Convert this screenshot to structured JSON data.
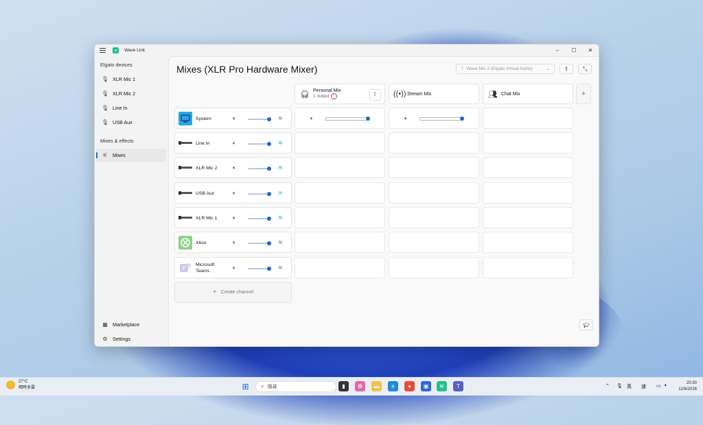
{
  "window": {
    "title": "Wave Link",
    "controls": [
      "–",
      "☐",
      "✕"
    ]
  },
  "sidebar": {
    "devices_heading": "Elgato devices",
    "devices": [
      {
        "label": "XLR Mic 1",
        "icon": "microphone-icon"
      },
      {
        "label": "XLR Mic 2",
        "icon": "microphone-icon"
      },
      {
        "label": "Line In",
        "icon": "microphone-icon"
      },
      {
        "label": "USB Aux",
        "icon": "microphone-icon"
      }
    ],
    "mixes_heading": "Mixes & effects",
    "mixes_item": "Mixes",
    "marketplace": "Marketplace",
    "settings": "Settings"
  },
  "main": {
    "title": "Mixes (XLR Pro Hardware Mixer)",
    "device_select": "Wave Mic 2 (Elgato Virtual Audio)",
    "mixes": [
      {
        "name": "Personal Mix",
        "sub": "1 output",
        "icon": "headphones-icon"
      },
      {
        "name": "Stream Mix",
        "icon": "broadcast-icon"
      },
      {
        "name": "Chat Mix",
        "icon": "people-icon"
      }
    ],
    "channels": [
      {
        "name": "System",
        "level": 0.9,
        "wave_active": false
      },
      {
        "name": "Line In",
        "level": 0.9,
        "wave_active": true
      },
      {
        "name": "XLR Mic 2",
        "level": 0.9,
        "wave_active": true
      },
      {
        "name": "USB Aux",
        "level": 0.9,
        "wave_active": true
      },
      {
        "name": "XLR Mic 1",
        "level": 0.9,
        "wave_active": true
      },
      {
        "name": "Xbox",
        "level": 0.9,
        "wave_active": false
      },
      {
        "name_line1": "Microsoft",
        "name_line2": "Teams",
        "level": 0.9,
        "wave_active": false
      }
    ],
    "system_personal_level": 1.0,
    "system_stream_level": 1.0,
    "create_channel": "Create channel"
  },
  "taskbar": {
    "weather_temp": "27°C",
    "weather_text": "晴時多雲",
    "search_placeholder": "搜尋",
    "lang_1": "英",
    "lang_2": "速",
    "time": "20:30",
    "date": "12/6/2026"
  },
  "colors": {
    "accent": "#1b6ac9",
    "wave_green": "#2fc47a",
    "warning": "#d33333"
  }
}
